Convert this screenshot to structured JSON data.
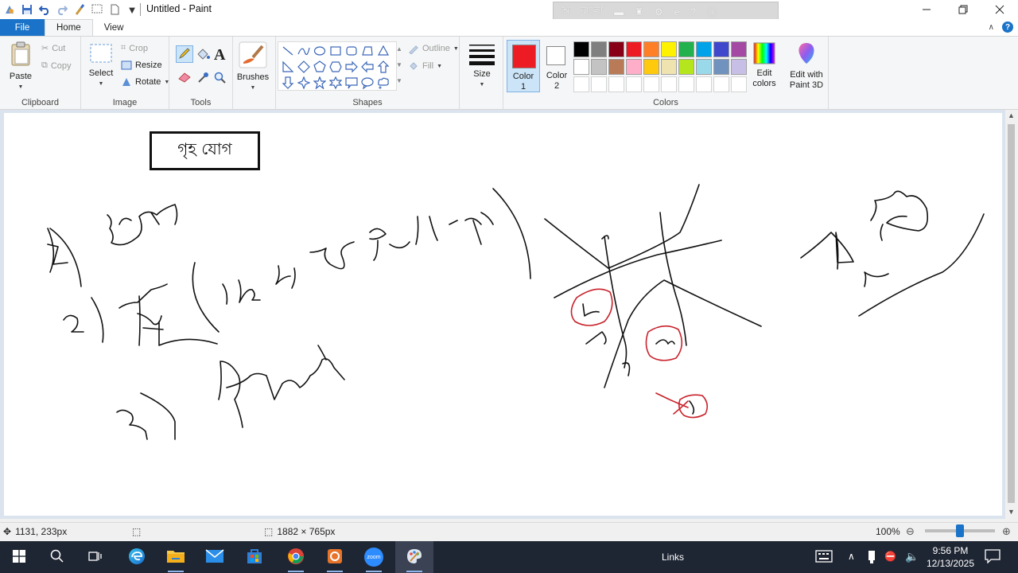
{
  "window": {
    "title": "Untitled - Paint",
    "ime_label": "বাংলা"
  },
  "tabs": [
    {
      "label": "File"
    },
    {
      "label": "Home"
    },
    {
      "label": "View"
    }
  ],
  "clipboard": {
    "paste_label": "Paste",
    "cut_label": "Cut",
    "copy_label": "Copy",
    "group_label": "Clipboard"
  },
  "image": {
    "select_label": "Select",
    "crop_label": "Crop",
    "resize_label": "Resize",
    "rotate_label": "Rotate",
    "group_label": "Image"
  },
  "tools": {
    "group_label": "Tools",
    "brushes_label": "Brushes"
  },
  "shapes": {
    "outline_label": "Outline",
    "fill_label": "Fill",
    "group_label": "Shapes"
  },
  "size": {
    "label": "Size"
  },
  "colors": {
    "color1_label": "Color\n1",
    "color1_a": "Color",
    "color1_b": "1",
    "color2_a": "Color",
    "color2_b": "2",
    "color1_value": "#ed1c24",
    "color2_value": "#ffffff",
    "edit_colors_a": "Edit",
    "edit_colors_b": "colors",
    "group_label": "Colors",
    "palette_row1": [
      "#000000",
      "#7f7f7f",
      "#880015",
      "#ed1c24",
      "#ff7f27",
      "#fff200",
      "#22b14c",
      "#00a2e8",
      "#3f48cc",
      "#a349a4"
    ],
    "palette_row2": [
      "#ffffff",
      "#c3c3c3",
      "#b97a57",
      "#ffaec9",
      "#ffc90e",
      "#efe4b0",
      "#b5e61d",
      "#99d9ea",
      "#7092be",
      "#c8bfe7"
    ]
  },
  "paint3d": {
    "label_a": "Edit with",
    "label_b": "Paint 3D"
  },
  "canvas": {
    "title_box_text": "গৃহ যোগ"
  },
  "status": {
    "cursor_pos": "1131, 233px",
    "image_size": "1882 × 765px",
    "zoom": "100%"
  },
  "taskbar": {
    "links_label": "Links",
    "time": "9:56 PM",
    "date": "12/13/2025",
    "zoom_app_label": "zoom"
  }
}
